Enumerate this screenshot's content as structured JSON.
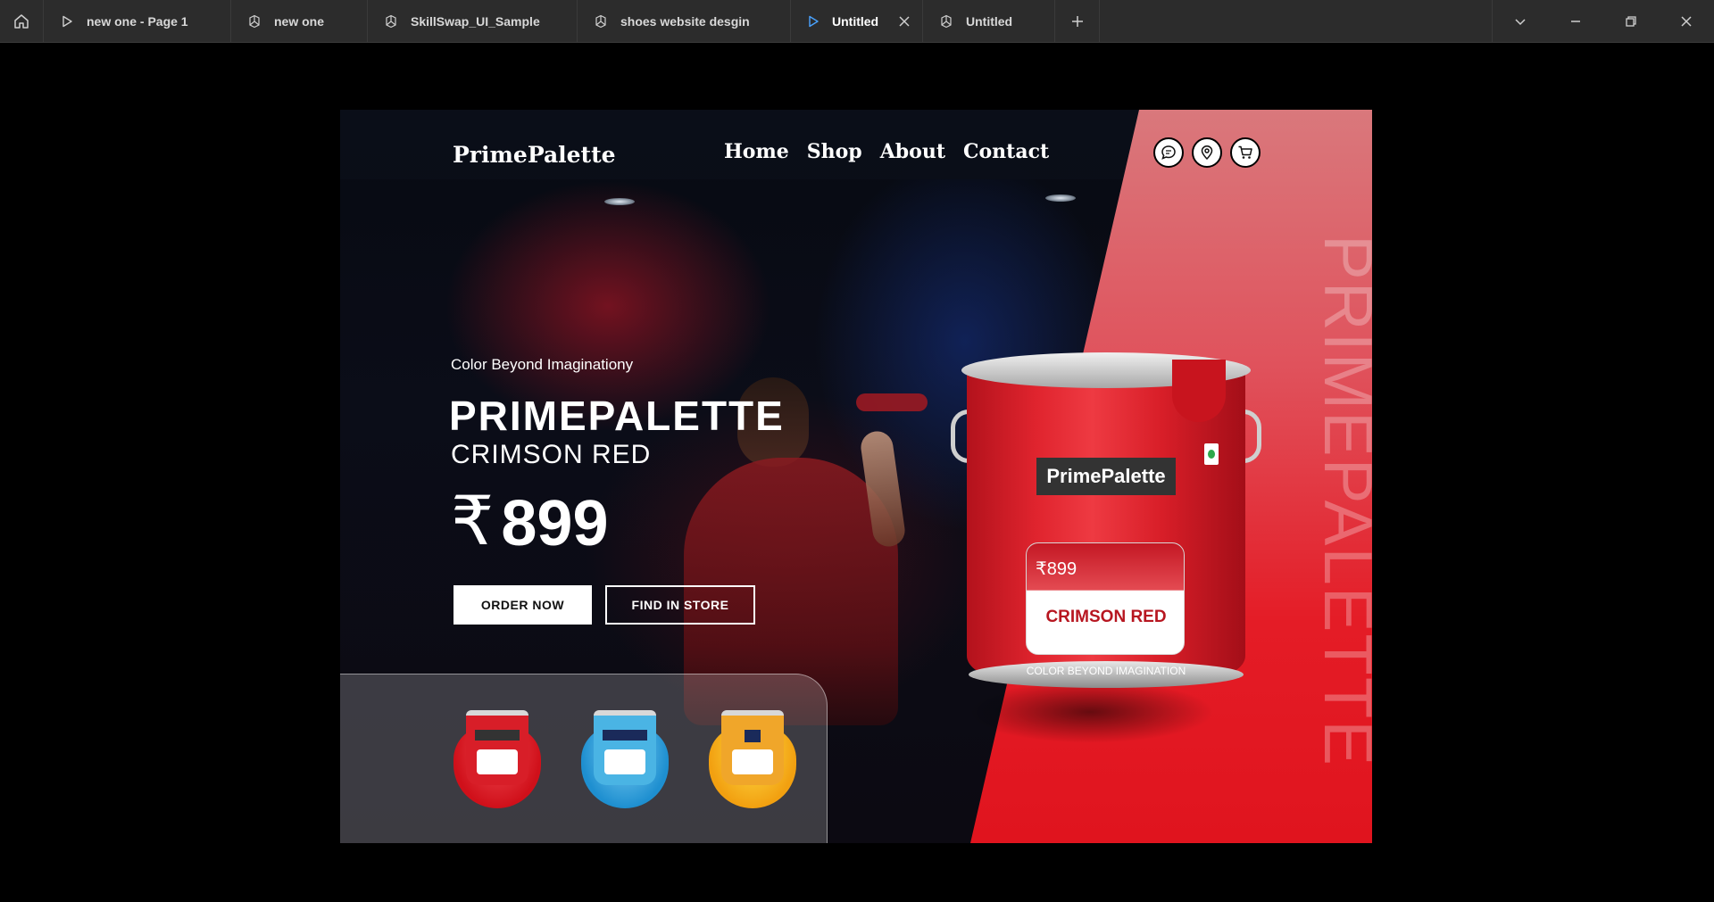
{
  "tabs": [
    {
      "label": "new one - Page 1",
      "icon": "play-icon",
      "active": false
    },
    {
      "label": "new one",
      "icon": "figma-file-icon",
      "active": false
    },
    {
      "label": "SkillSwap_UI_Sample",
      "icon": "figma-file-icon",
      "active": false
    },
    {
      "label": "shoes website desgin",
      "icon": "figma-file-icon",
      "active": false
    },
    {
      "label": "Untitled",
      "icon": "play-icon",
      "active": true
    },
    {
      "label": "Untitled",
      "icon": "figma-file-icon",
      "active": false
    }
  ],
  "titlebar_icons": {
    "home": "home-icon",
    "new_tab": "plus-icon",
    "menu": "chevron-down-icon",
    "minimize": "minimize-icon",
    "restore": "restore-icon",
    "close": "close-icon"
  },
  "site": {
    "logo": "PrimePalette",
    "nav": [
      "Home",
      "Shop",
      "About",
      "Contact"
    ],
    "nav_icons": [
      "chat-icon",
      "location-pin-icon",
      "cart-icon"
    ],
    "watermark": "PRIMEPALETTE"
  },
  "hero": {
    "tagline": "Color Beyond Imaginationy",
    "title": "PRIMEPALETTE",
    "subtitle": "CRIMSON RED",
    "currency_symbol": "₹",
    "price": "899",
    "order_label": "ORDER NOW",
    "store_label": "FIND IN STORE"
  },
  "product": {
    "brand": "PrimePalette",
    "price_label": "₹899",
    "name": "CRIMSON RED",
    "slogan": "COLOR BEYOND IMAGINATION"
  },
  "swatches": [
    {
      "name": "crimson-red",
      "color": "#e0141e"
    },
    {
      "name": "sky-blue",
      "color": "#2fa6df"
    },
    {
      "name": "sunflower-yellow",
      "color": "#f5b21c"
    }
  ],
  "colors": {
    "accent_red": "#e41c26",
    "titlebar_bg": "#2c2c2c"
  }
}
